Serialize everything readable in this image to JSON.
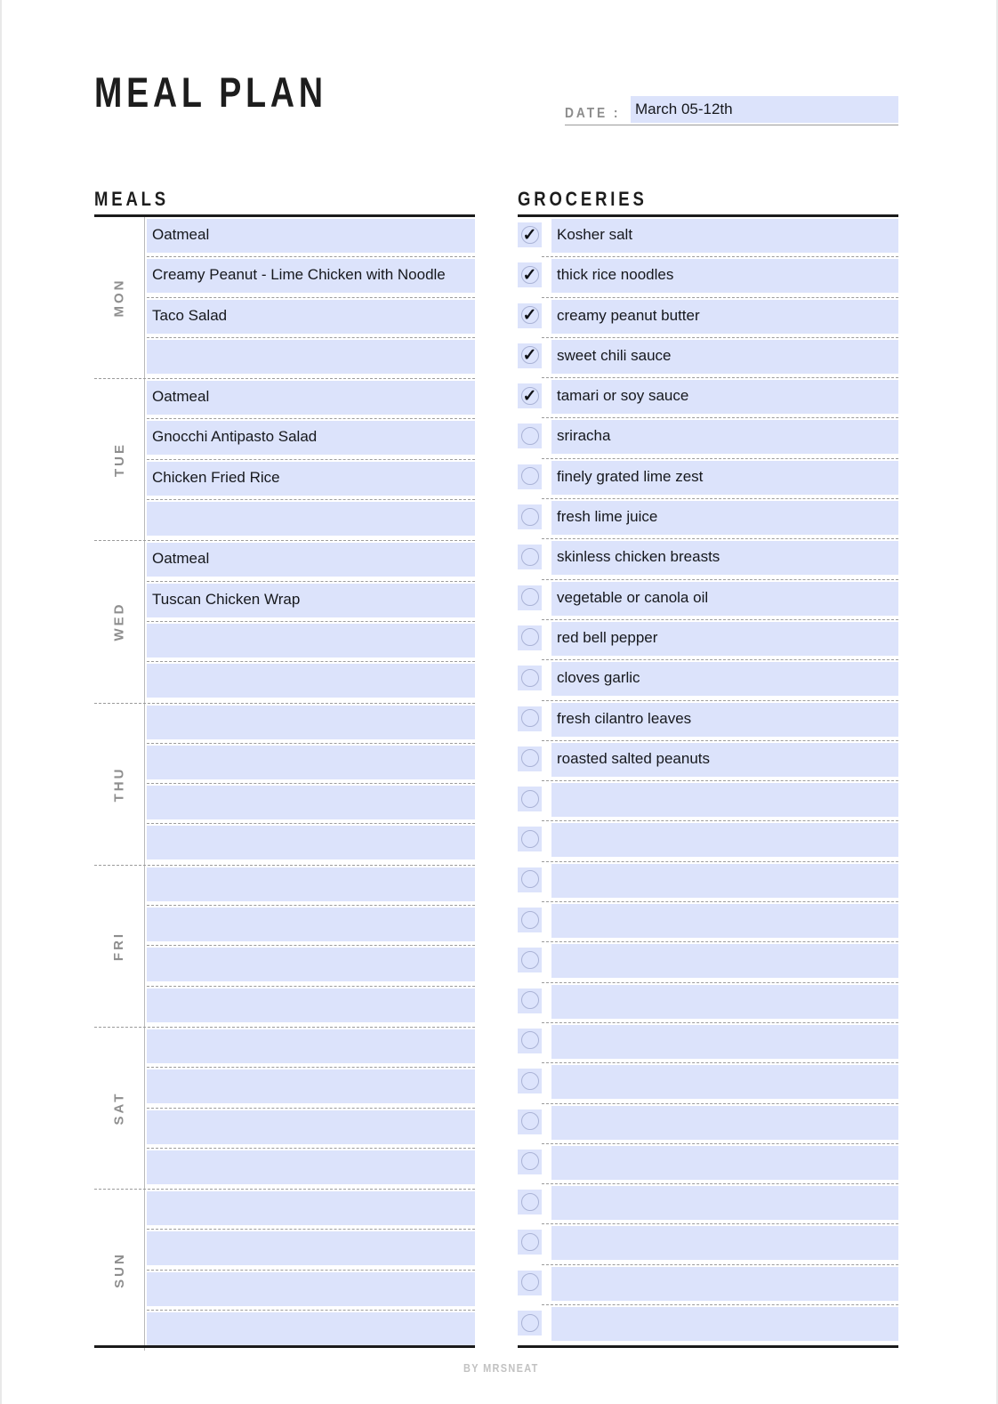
{
  "header": {
    "title": "MEAL PLAN",
    "date_label": "DATE :",
    "date_value": "March 05-12th"
  },
  "meals": {
    "heading": "MEALS",
    "days": [
      {
        "label": "MON",
        "slots": [
          "Oatmeal",
          "Creamy Peanut - Lime Chicken with Noodle",
          "Taco Salad",
          ""
        ]
      },
      {
        "label": "TUE",
        "slots": [
          "Oatmeal",
          "Gnocchi Antipasto Salad",
          "Chicken Fried Rice",
          ""
        ]
      },
      {
        "label": "WED",
        "slots": [
          "Oatmeal",
          "Tuscan Chicken Wrap",
          "",
          ""
        ]
      },
      {
        "label": "THU",
        "slots": [
          "",
          "",
          "",
          ""
        ]
      },
      {
        "label": "FRI",
        "slots": [
          "",
          "",
          "",
          ""
        ]
      },
      {
        "label": "SAT",
        "slots": [
          "",
          "",
          "",
          ""
        ]
      },
      {
        "label": "SUN",
        "slots": [
          "",
          "",
          "",
          ""
        ]
      }
    ]
  },
  "groceries": {
    "heading": "GROCERIES",
    "check_glyph": "✓",
    "items": [
      {
        "text": "Kosher salt",
        "checked": true
      },
      {
        "text": "thick rice noodles",
        "checked": true
      },
      {
        "text": "creamy peanut butter",
        "checked": true
      },
      {
        "text": "sweet chili sauce",
        "checked": true
      },
      {
        "text": "tamari or soy sauce",
        "checked": true
      },
      {
        "text": "sriracha",
        "checked": false
      },
      {
        "text": "finely grated lime zest",
        "checked": false
      },
      {
        "text": "fresh lime juice",
        "checked": false
      },
      {
        "text": "skinless chicken breasts",
        "checked": false
      },
      {
        "text": "vegetable or canola oil",
        "checked": false
      },
      {
        "text": "red bell pepper",
        "checked": false
      },
      {
        "text": "cloves garlic",
        "checked": false
      },
      {
        "text": "fresh cilantro leaves",
        "checked": false
      },
      {
        "text": "roasted salted peanuts",
        "checked": false
      },
      {
        "text": "",
        "checked": false
      },
      {
        "text": "",
        "checked": false
      },
      {
        "text": "",
        "checked": false
      },
      {
        "text": "",
        "checked": false
      },
      {
        "text": "",
        "checked": false
      },
      {
        "text": "",
        "checked": false
      },
      {
        "text": "",
        "checked": false
      },
      {
        "text": "",
        "checked": false
      },
      {
        "text": "",
        "checked": false
      },
      {
        "text": "",
        "checked": false
      },
      {
        "text": "",
        "checked": false
      },
      {
        "text": "",
        "checked": false
      },
      {
        "text": "",
        "checked": false
      },
      {
        "text": "",
        "checked": false
      }
    ]
  },
  "footer": {
    "credit": "BY MRSNEAT"
  },
  "colors": {
    "field_blue": "#dce3fb",
    "ink": "#16181d",
    "muted": "#8e8e8e",
    "rule": "#1b1b1b"
  }
}
